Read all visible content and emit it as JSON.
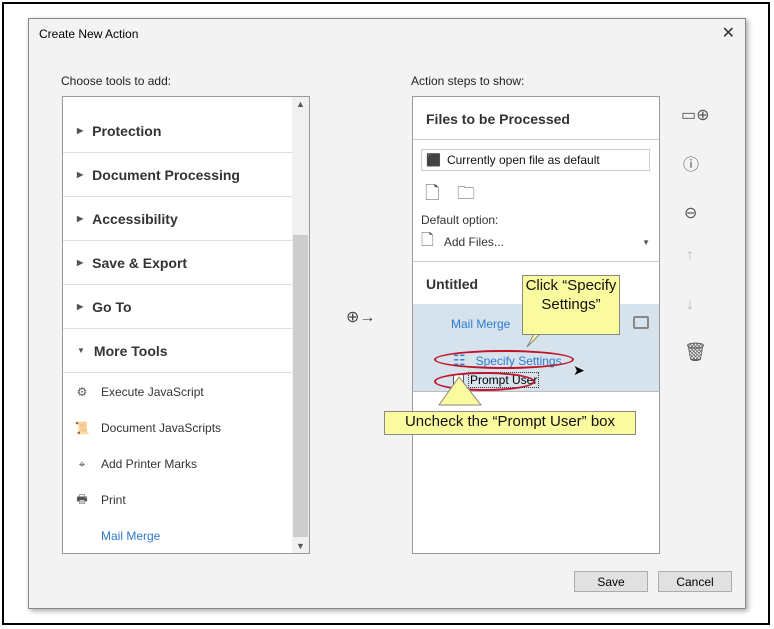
{
  "dialog": {
    "title": "Create New Action",
    "close": "✕"
  },
  "left": {
    "label": "Choose tools to add:",
    "categories": [
      "Protection",
      "Document Processing",
      "Accessibility",
      "Save & Export",
      "Go To",
      "More Tools"
    ],
    "tools": [
      "Execute JavaScript",
      "Document JavaScripts",
      "Add Printer Marks",
      "Print",
      "Mail Merge"
    ]
  },
  "right": {
    "label": "Action steps to show:",
    "files_header": "Files to be Processed",
    "file_field": "Currently open file as default",
    "default_option_label": "Default option:",
    "add_files": "Add Files...",
    "action_title": "Untitled",
    "step_name": "Mail Merge",
    "specify_settings": "Specify Settings",
    "prompt_user": "Prompt User",
    "prompt_user_checked": false
  },
  "callouts": {
    "click": "Click “Specify Settings”",
    "uncheck": "Uncheck the “Prompt User” box"
  },
  "buttons": {
    "save": "Save",
    "cancel": "Cancel"
  },
  "colors": {
    "accent": "#2d7bd1",
    "callout": "#fafa9e",
    "highlight": "#c0152a",
    "selected_step": "#d6e2ec"
  }
}
